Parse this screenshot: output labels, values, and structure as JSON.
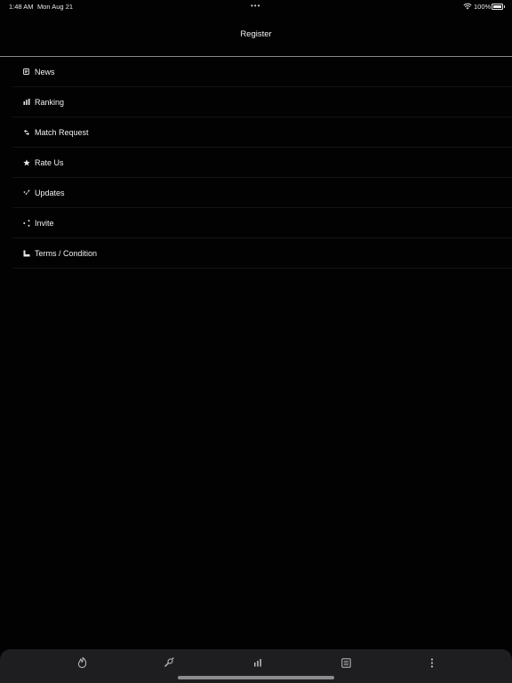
{
  "status_bar": {
    "time": "1:48 AM",
    "date": "Mon Aug 21",
    "multitask_dots": "•••",
    "battery_percent": "100%",
    "battery_level": 1.0
  },
  "nav": {
    "title": "Register"
  },
  "menu": {
    "items": [
      {
        "label": "News",
        "icon": "newspaper-icon"
      },
      {
        "label": "Ranking",
        "icon": "bar-chart-icon"
      },
      {
        "label": "Match Request",
        "icon": "swap-icon"
      },
      {
        "label": "Rate Us",
        "icon": "star-icon"
      },
      {
        "label": "Updates",
        "icon": "refresh-icon"
      },
      {
        "label": "Invite",
        "icon": "share-icon"
      },
      {
        "label": "Terms / Condition",
        "icon": "chart-document-icon"
      }
    ]
  },
  "tab_bar": {
    "tabs": [
      {
        "name": "fire-icon"
      },
      {
        "name": "racket-icon"
      },
      {
        "name": "bar-chart-icon"
      },
      {
        "name": "news-icon"
      },
      {
        "name": "more-vertical-icon"
      }
    ]
  },
  "colors": {
    "background": "#020203",
    "text": "#f2f2f2",
    "nav_separator": "#8a8a8e",
    "row_separator": "#141416",
    "tab_bar": "#1e1e20",
    "tab_icon": "#bdbdc2"
  }
}
